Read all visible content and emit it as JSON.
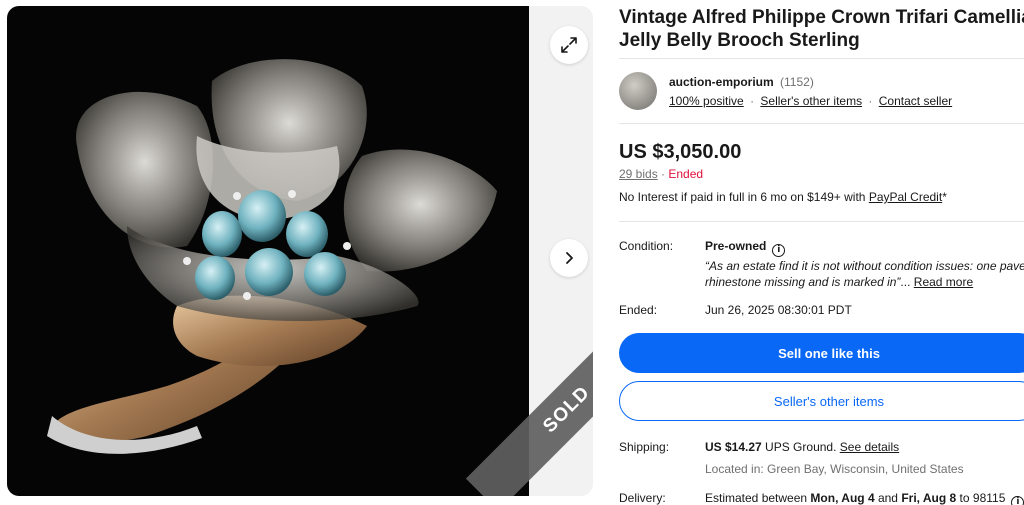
{
  "listing": {
    "title_line1": "Vintage Alfred Philippe Crown Trifari Camellia",
    "title_line2": "Jelly Belly Brooch Sterling"
  },
  "gallery": {
    "sold_label": "SOLD",
    "expand_icon": "expand-icon",
    "next_icon": "chevron-right-icon"
  },
  "seller": {
    "name": "auction-emporium",
    "feedback_count": "(1152)",
    "positive": "100% positive",
    "other_items": "Seller's other items",
    "contact": "Contact seller",
    "separator": "·"
  },
  "pricing": {
    "price": "US $3,050.00",
    "bids": "29 bids",
    "bids_separator": " · ",
    "status": "Ended",
    "credit_prefix": "No Interest if paid in full in 6 mo on $149+ with ",
    "credit_link": "PayPal Credit",
    "credit_suffix": "*"
  },
  "details": {
    "condition_label": "Condition:",
    "condition_value": "Pre-owned",
    "condition_quote_line1": "“As an estate find it is not without condition issues: one pave",
    "condition_quote_line2": "rhinestone missing and is marked in”",
    "ellipsis": "...",
    "read_more": "Read more",
    "ended_label": "Ended:",
    "ended_value": "Jun 26, 2025 08:30:01 PDT"
  },
  "actions": {
    "sell_one": "Sell one like this",
    "sellers_items": "Seller's other items"
  },
  "shipping": {
    "label": "Shipping:",
    "price": "US $14.27",
    "method": " UPS Ground. ",
    "see_details": "See details",
    "location": "Located in: Green Bay, Wisconsin, United States"
  },
  "delivery": {
    "label": "Delivery:",
    "prefix": "Estimated between ",
    "start": "Mon, Aug 4",
    "middle": " and ",
    "end": "Fri, Aug 8",
    "suffix": " to 98115"
  },
  "colors": {
    "accent": "#0968f6",
    "ended": "#e0103a",
    "ribbon": "#5f5f5f"
  }
}
